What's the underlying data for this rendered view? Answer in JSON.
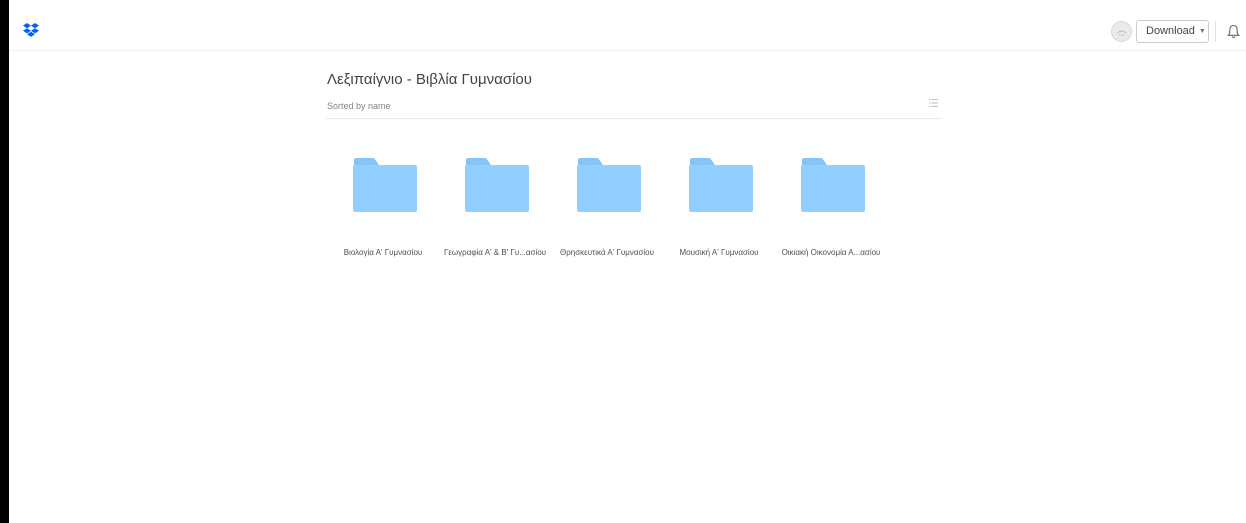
{
  "header": {
    "logo_icon": "dropbox-icon",
    "download_label": "Download",
    "download_caret_icon": "caret-down-icon",
    "avatar_icon": "user-avatar",
    "notification_icon": "bell-icon"
  },
  "folder": {
    "title": "Λεξιπαίγνιο - Βιβλία Γυμνασίου",
    "sort_label": "Sorted by name",
    "view_toggle_icon": "list-view-icon"
  },
  "items": [
    {
      "name": "Βιολογία Α' Γυμνασίου",
      "icon": "folder-icon"
    },
    {
      "name": "Γεωγραφία Α' & Β' Γυ...ασίου",
      "icon": "folder-icon"
    },
    {
      "name": "Θρησκευτικά Α' Γυμνασίου",
      "icon": "folder-icon"
    },
    {
      "name": "Μουσική Α' Γυμνασίου",
      "icon": "folder-icon"
    },
    {
      "name": "Οικιακή Οικονομία Α...ασίου",
      "icon": "folder-icon"
    }
  ],
  "colors": {
    "brand": "#0061fe",
    "folder": "#92ceff",
    "folder_tab": "#86c4f8",
    "text": "#3d464d"
  }
}
